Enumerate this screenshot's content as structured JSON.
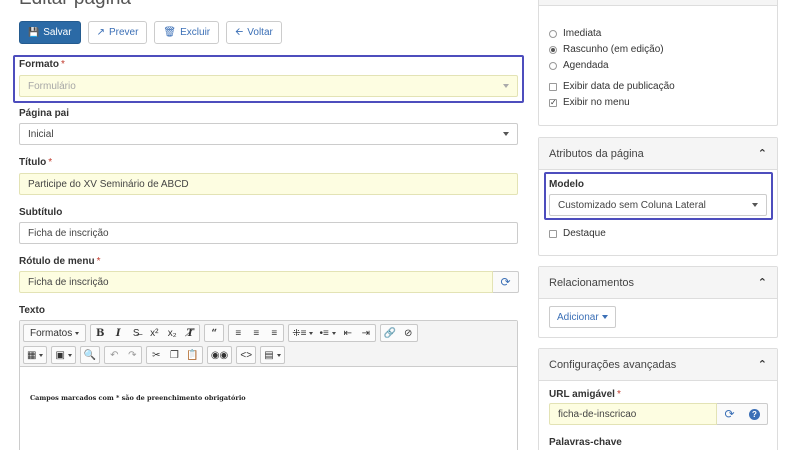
{
  "page": {
    "title": "Editar página"
  },
  "toolbar": {
    "save_label": "Salvar",
    "preview_label": "Prever",
    "delete_label": "Excluir",
    "back_label": "Voltar"
  },
  "form": {
    "formato": {
      "label": "Formato",
      "required_mark": "*",
      "placeholder": "Formulário"
    },
    "pagina_pai": {
      "label": "Página pai",
      "value": "Inicial"
    },
    "titulo": {
      "label": "Título",
      "required_mark": "*",
      "value": "Participe do XV Seminário de ABCD"
    },
    "subtitulo": {
      "label": "Subtítulo",
      "value": "Ficha de inscrição"
    },
    "rotulo_menu": {
      "label": "Rótulo de menu",
      "required_mark": "*",
      "value": "Ficha de inscrição"
    },
    "texto": {
      "label": "Texto",
      "formats_label": "Formatos",
      "content": "Campos marcados com * são de preenchimento obrigatório"
    }
  },
  "publish_panel": {
    "options": [
      {
        "label": "Imediata",
        "type": "radio",
        "checked": false
      },
      {
        "label": "Rascunho (em edição)",
        "type": "radio",
        "checked": true
      },
      {
        "label": "Agendada",
        "type": "radio",
        "checked": false
      },
      {
        "label": "Exibir data de publicação",
        "type": "checkbox",
        "checked": false
      },
      {
        "label": "Exibir no menu",
        "type": "checkbox",
        "checked": true
      }
    ]
  },
  "attributes_panel": {
    "title": "Atributos da página",
    "modelo_label": "Modelo",
    "modelo_value": "Customizado sem Coluna Lateral",
    "destaque_label": "Destaque"
  },
  "relations_panel": {
    "title": "Relacionamentos",
    "add_label": "Adicionar"
  },
  "advanced_panel": {
    "title": "Configurações avançadas",
    "url_label": "URL amigável",
    "url_required_mark": "*",
    "url_value": "ficha-de-inscricao",
    "keywords_label": "Palavras-chave"
  },
  "colors": {
    "primary": "#2b6aa6",
    "link": "#3b6fb6",
    "highlight": "#4d4dbd",
    "required_field_bg": "#fdfde1"
  }
}
